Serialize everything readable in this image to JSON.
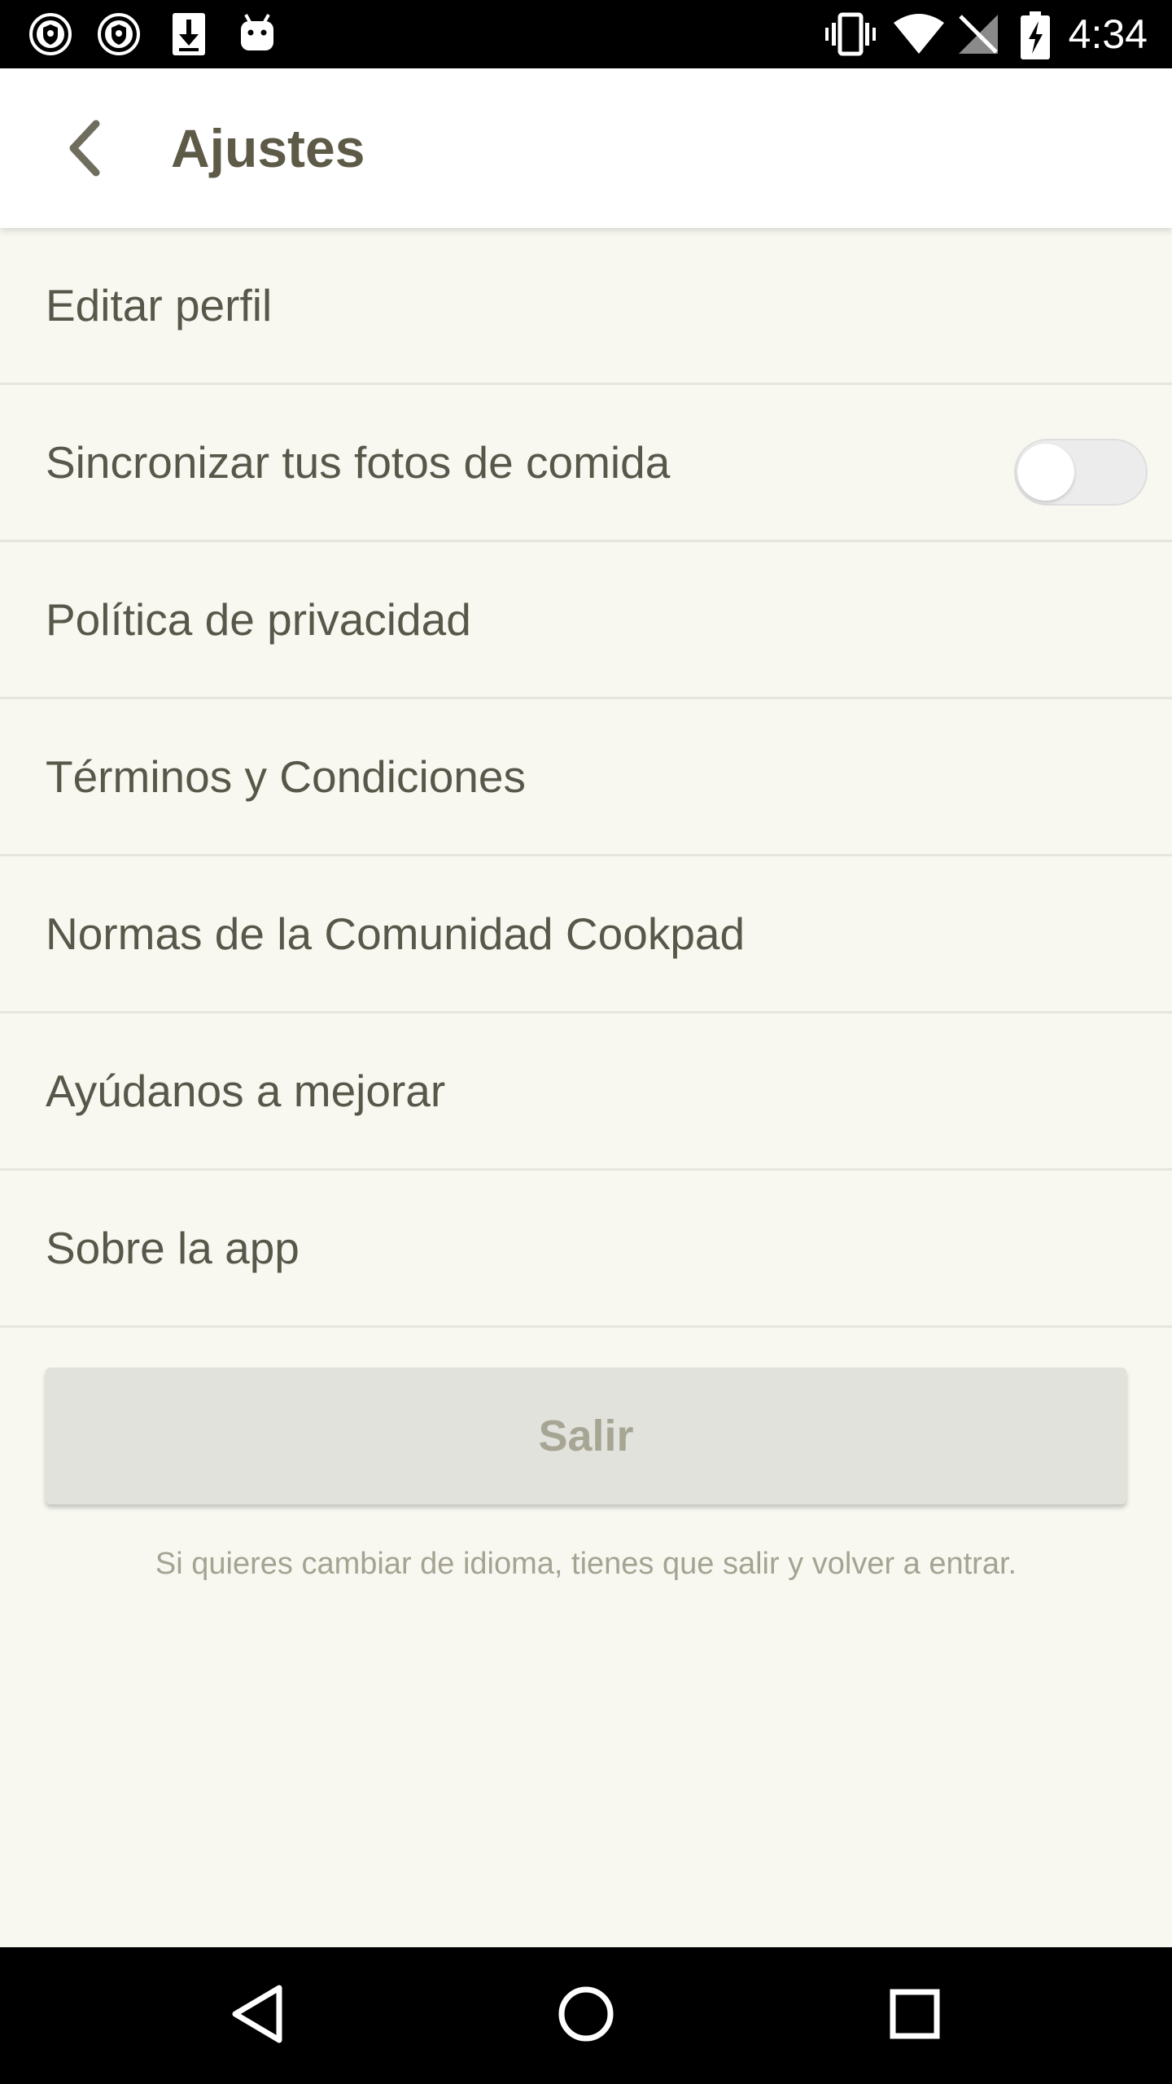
{
  "status_bar": {
    "time": "4:34",
    "left_icons": [
      "shield-notification-icon",
      "shield-notification-icon",
      "download-icon",
      "android-icon"
    ],
    "right_icons": [
      "vibrate-icon",
      "wifi-icon",
      "no-signal-icon",
      "battery-charging-icon"
    ]
  },
  "app_bar": {
    "back_icon": "chevron-left-icon",
    "title": "Ajustes"
  },
  "settings": {
    "items": [
      {
        "label": "Editar perfil"
      },
      {
        "label": "Sincronizar tus fotos de comida",
        "toggle_on": false
      },
      {
        "label": "Política de privacidad"
      },
      {
        "label": "Términos y Condiciones"
      },
      {
        "label": "Normas de la Comunidad Cookpad"
      },
      {
        "label": "Ayúdanos a mejorar"
      },
      {
        "label": "Sobre la app"
      }
    ]
  },
  "logout": {
    "label": "Salir"
  },
  "language_hint": "Si quieres cambiar de idioma, tienes que salir y volver a entrar.",
  "nav_bar": {
    "icons": [
      "back-triangle-icon",
      "home-circle-icon",
      "recents-square-icon"
    ]
  },
  "colors": {
    "background": "#f8f8f1",
    "app_bar": "#ffffff",
    "title_text": "#5d5a48",
    "item_text": "#58584a",
    "divider": "#e6e6df",
    "button_bg": "#e2e2dd",
    "button_text": "#a7a694",
    "hint_text": "#a5a392"
  }
}
